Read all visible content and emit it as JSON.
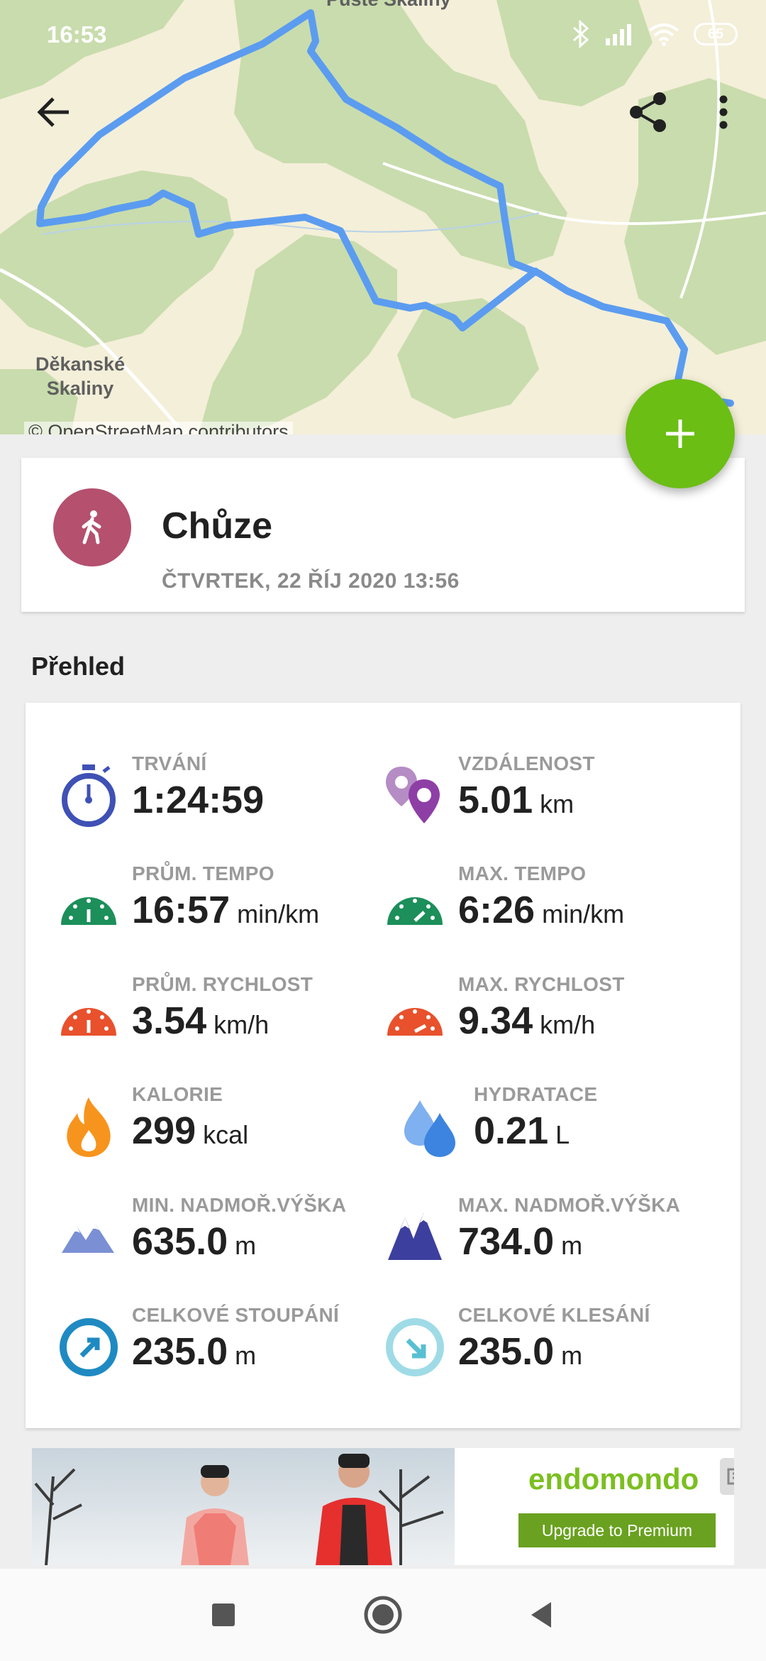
{
  "status_bar": {
    "time": "16:53",
    "battery": "65"
  },
  "map": {
    "label_top": "Pusté Skaliny",
    "label_place_line1": "Děkanské",
    "label_place_line2": "Skaliny",
    "attribution": "© OpenStreetMap contributors",
    "route_color": "#5b9cf0",
    "forest_color": "#c9dcad",
    "land_color": "#f4efd9"
  },
  "toolbar": {
    "back_icon": "arrow-back-icon",
    "share_icon": "share-icon",
    "more_icon": "more-vert-icon"
  },
  "fab": {
    "icon": "plus-icon",
    "color": "#6bbe14"
  },
  "activity": {
    "name": "Chůze",
    "date": "ČTVRTEK, 22 ŘÍJ 2020 13:56",
    "icon": "walking-icon",
    "icon_color": "#b5506f"
  },
  "overview": {
    "title": "Přehled",
    "stats": [
      {
        "label": "TRVÁNÍ",
        "value": "1:24:59",
        "unit": "",
        "icon": "stopwatch-icon"
      },
      {
        "label": "VZDÁLENOST",
        "value": "5.01",
        "unit": "km",
        "icon": "map-pins-icon"
      },
      {
        "label": "PRŮM. TEMPO",
        "value": "16:57",
        "unit": "min/km",
        "icon": "speedometer-green-icon"
      },
      {
        "label": "MAX. TEMPO",
        "value": "6:26",
        "unit": "min/km",
        "icon": "speedometer-green-max-icon"
      },
      {
        "label": "PRŮM. RYCHLOST",
        "value": "3.54",
        "unit": "km/h",
        "icon": "speedometer-red-icon"
      },
      {
        "label": "MAX. RYCHLOST",
        "value": "9.34",
        "unit": "km/h",
        "icon": "speedometer-red-max-icon"
      },
      {
        "label": "KALORIE",
        "value": "299",
        "unit": "kcal",
        "icon": "flame-icon"
      },
      {
        "label": "HYDRATACE",
        "value": "0.21",
        "unit": "L",
        "icon": "water-drops-icon"
      },
      {
        "label": "MIN. NADMOŘ.VÝŠKA",
        "value": "635.0",
        "unit": "m",
        "icon": "mountains-light-icon"
      },
      {
        "label": "MAX. NADMOŘ.VÝŠKA",
        "value": "734.0",
        "unit": "m",
        "icon": "mountains-dark-icon"
      },
      {
        "label": "CELKOVÉ STOUPÁNÍ",
        "value": "235.0",
        "unit": "m",
        "icon": "ascent-arrow-icon"
      },
      {
        "label": "CELKOVÉ KLESÁNÍ",
        "value": "235.0",
        "unit": "m",
        "icon": "descent-arrow-icon"
      }
    ]
  },
  "ad": {
    "brand": "endomondo",
    "cta": "Upgrade to Premium"
  },
  "nav": {
    "recents_icon": "square-icon",
    "home_icon": "circle-icon",
    "back_icon": "triangle-back-icon"
  }
}
